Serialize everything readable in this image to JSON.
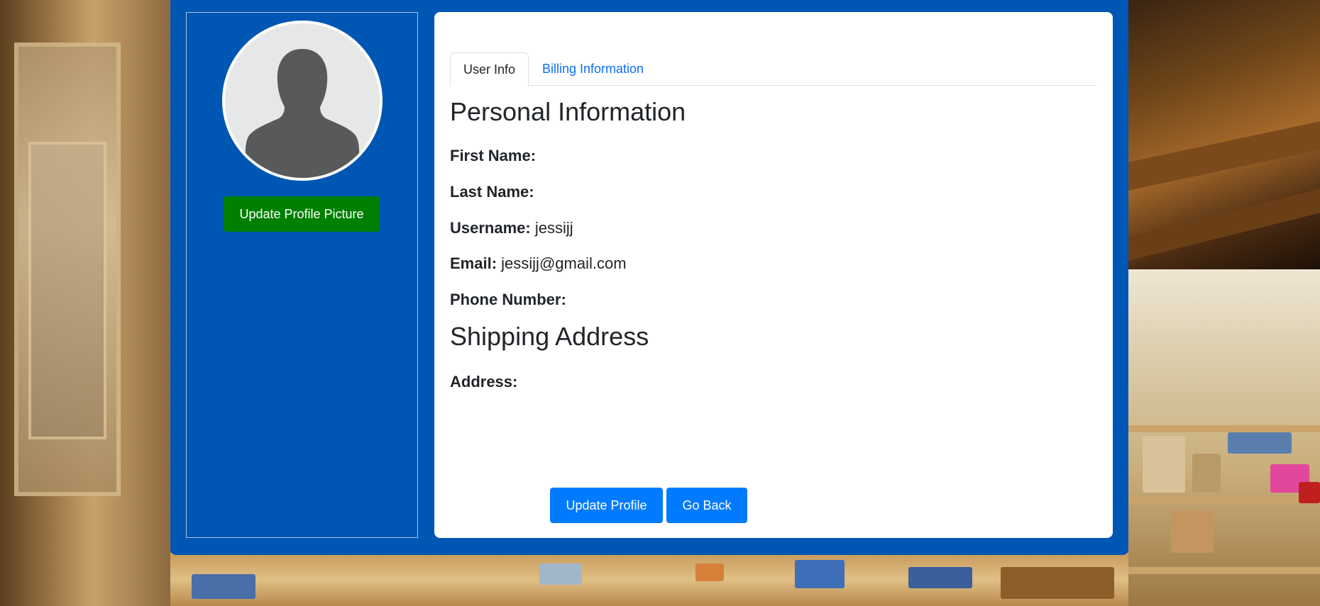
{
  "sidebar": {
    "update_picture_label": "Update Profile Picture"
  },
  "tabs": [
    {
      "label": "User Info",
      "active": true
    },
    {
      "label": "Billing Information",
      "active": false
    }
  ],
  "personal": {
    "title": "Personal Information",
    "first_name_label": "First Name:",
    "first_name_value": "",
    "last_name_label": "Last Name:",
    "last_name_value": "",
    "username_label": "Username:",
    "username_value": "jessijj",
    "email_label": "Email:",
    "email_value": "jessijj@gmail.com",
    "phone_label": "Phone Number:",
    "phone_value": ""
  },
  "shipping": {
    "title": "Shipping Address",
    "address_label": "Address:",
    "address_value": ""
  },
  "actions": {
    "update_profile_label": "Update Profile",
    "go_back_label": "Go Back"
  },
  "colors": {
    "panel": "#0056b3",
    "update_picture_button": "#008000",
    "primary_button": "#007bff",
    "tab_link": "#0d6efd"
  }
}
